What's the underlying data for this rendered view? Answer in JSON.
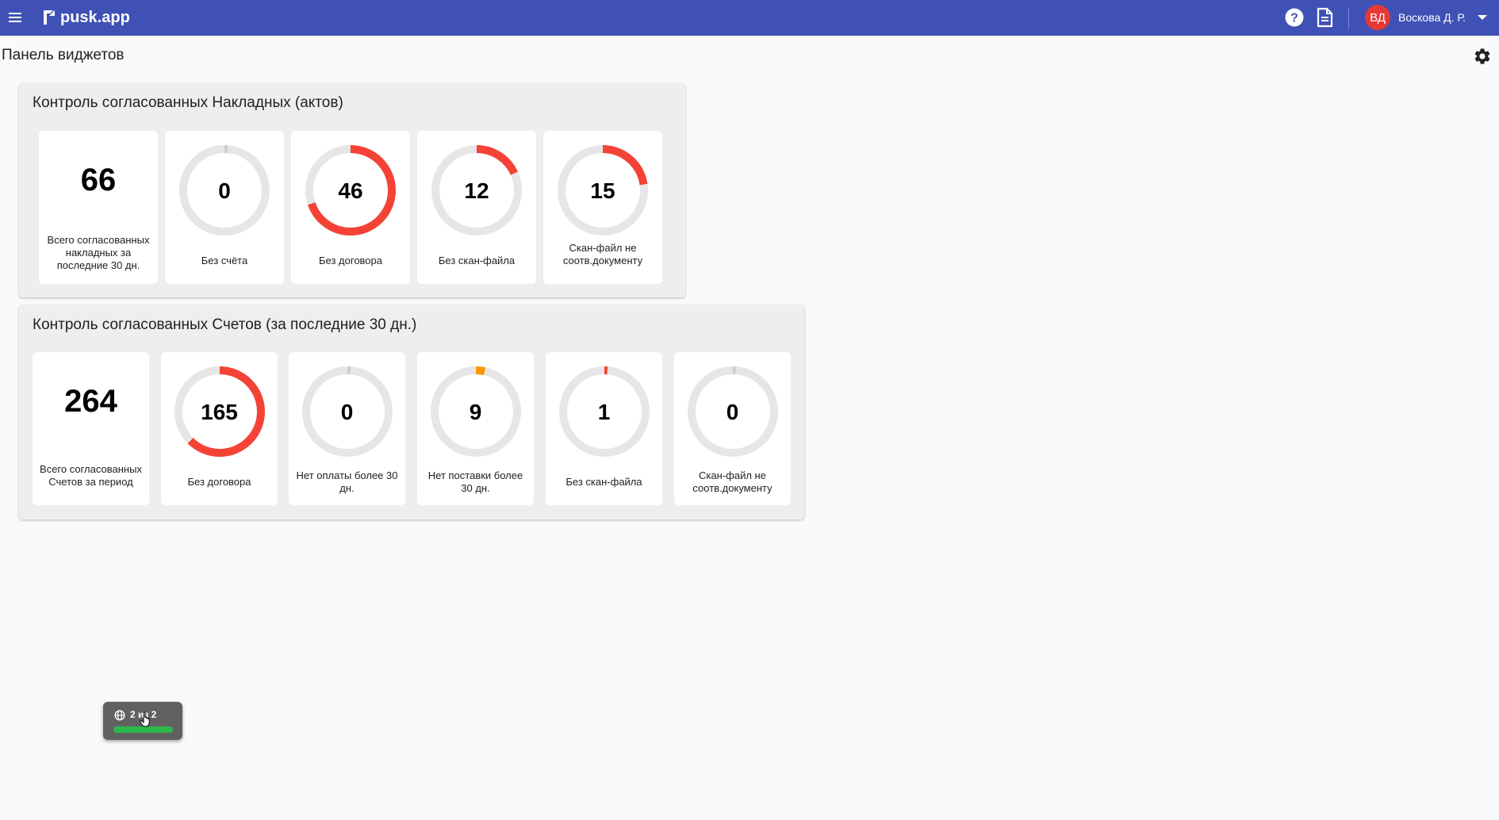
{
  "header": {
    "logo_text": "pusk.app",
    "user_initials": "ВД",
    "user_name": "Воскова Д. Р.",
    "bar_color": "#3f51b5",
    "icons": [
      "menu-icon",
      "logo-icon",
      "help-icon",
      "document-icon",
      "caret-down-icon"
    ]
  },
  "page": {
    "title": "Панель виджетов",
    "settings_icon": "gear-icon"
  },
  "widgets": [
    {
      "title": "Контроль согласованных Накладных (актов)",
      "tiles": [
        {
          "value": "66",
          "label": "Всего согласованных накладных за последние 30 дн.",
          "kind": "number"
        },
        {
          "value": "0",
          "label": "Без счёта",
          "kind": "ring",
          "fraction": 0,
          "color": "#f44336"
        },
        {
          "value": "46",
          "label": "Без договора",
          "kind": "ring",
          "fraction": 0.697,
          "color": "#f44336"
        },
        {
          "value": "12",
          "label": "Без скан-файла",
          "kind": "ring",
          "fraction": 0.182,
          "color": "#f44336"
        },
        {
          "value": "15",
          "label": "Скан-файл не соотв.документу",
          "kind": "ring",
          "fraction": 0.227,
          "color": "#f44336"
        }
      ]
    },
    {
      "title": "Контроль согласованных Счетов (за последние 30 дн.)",
      "tiles": [
        {
          "value": "264",
          "label": "Всего согласованных Счетов за период",
          "kind": "number"
        },
        {
          "value": "165",
          "label": "Без договора",
          "kind": "ring",
          "fraction": 0.625,
          "color": "#f44336"
        },
        {
          "value": "0",
          "label": "Нет оплаты более 30 дн.",
          "kind": "ring",
          "fraction": 0,
          "color": "#f44336"
        },
        {
          "value": "9",
          "label": "Нет поставки более 30 дн.",
          "kind": "ring",
          "fraction": 0.034,
          "color": "#ff9800"
        },
        {
          "value": "1",
          "label": "Без скан-файла",
          "kind": "ring",
          "fraction": 0.004,
          "color": "#f44336"
        },
        {
          "value": "0",
          "label": "Скан-файл не соотв.документу",
          "kind": "ring",
          "fraction": 0,
          "color": "#f44336"
        }
      ]
    }
  ],
  "toast": {
    "text": "2 из 2",
    "icon": "globe-icon",
    "progress": 1.0,
    "bar_color": "#2db84d"
  }
}
